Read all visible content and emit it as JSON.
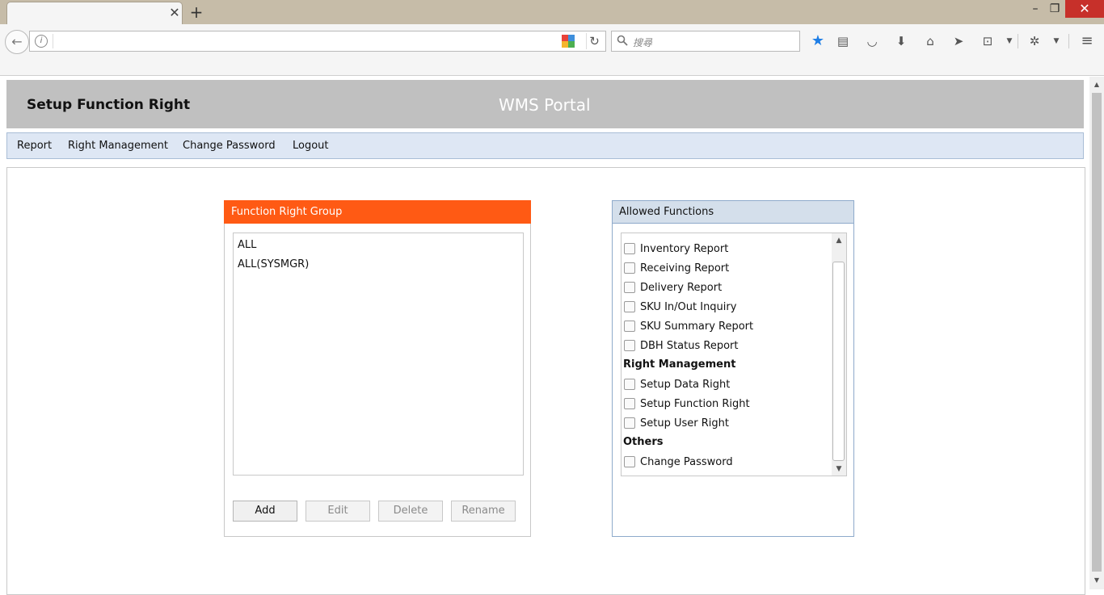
{
  "browser": {
    "search_placeholder": "搜尋",
    "url_value": ""
  },
  "header": {
    "title": "Setup Function Right",
    "portal": "WMS Portal"
  },
  "menu": [
    {
      "label": "Report"
    },
    {
      "label": "Right Management"
    },
    {
      "label": "Change Password"
    },
    {
      "label": "Logout"
    }
  ],
  "group_panel": {
    "title": "Function Right Group",
    "items": [
      "ALL",
      "ALL(SYSMGR)"
    ],
    "buttons": {
      "add": "Add",
      "edit": "Edit",
      "delete": "Delete",
      "rename": "Rename"
    }
  },
  "functions_panel": {
    "title": "Allowed Functions",
    "report_items": [
      "Inventory Report",
      "Receiving Report",
      "Delivery Report",
      "SKU In/Out Inquiry",
      "SKU Summary Report",
      "DBH Status Report"
    ],
    "right_mgmt_heading": "Right Management",
    "right_mgmt_items": [
      "Setup Data Right",
      "Setup Function Right",
      "Setup User Right"
    ],
    "others_heading": "Others",
    "others_items": [
      "Change Password"
    ]
  },
  "colors": {
    "accent_orange": "#ff5a14",
    "header_gray": "#c0c0c0",
    "menu_blue": "#dee7f4",
    "star_blue": "#1e7ee6"
  },
  "icons": [
    "arrow-left-icon",
    "info-icon",
    "reload-icon",
    "search-icon",
    "star-icon",
    "reading-list-icon",
    "pocket-icon",
    "download-icon",
    "home-icon",
    "send-icon",
    "crop-icon",
    "addon-icon",
    "menu-icon",
    "close-icon",
    "plus-icon"
  ]
}
